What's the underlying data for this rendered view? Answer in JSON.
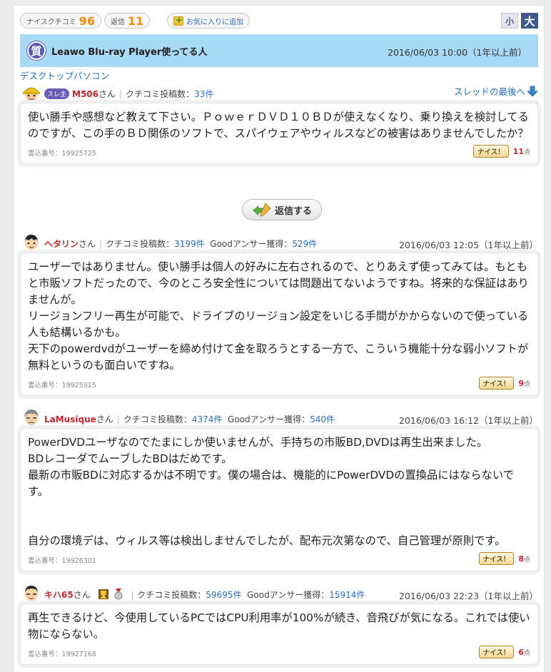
{
  "toolbar": {
    "nice_label": "ナイスクチコミ",
    "nice_count": "96",
    "reply_label": "返信",
    "reply_count": "11",
    "favorite_label": "お気に入りに追加",
    "size_small": "小",
    "size_large": "大"
  },
  "question": {
    "badge": "質",
    "title": "Leawo Blu-ray Player使ってる人",
    "date": "2016/06/03 10:00（1年以上前）",
    "category": "デスクトップパソコン",
    "last_link": "スレッドの最後へ"
  },
  "reply_button": "返信する",
  "labels": {
    "san": "さん",
    "post_count": "クチコミ投稿数：",
    "good_answer": "Goodアンサー獲得：",
    "thread_owner": "スレ主",
    "nice": "ナイス！",
    "points_unit": "点"
  },
  "posts": [
    {
      "user": "M506",
      "posts_count": "33件",
      "good_count": "",
      "date": "",
      "body": "使い勝手や感想など教えて下さい。ＰｏｗｅｒＤＶＤ１０ＢＤが使えなくなり、乗り換えを検討してるのですが、この手のＢＤ関係のソフトで、スパイウェアやウィルスなどの被害はありませんでしたか？",
      "post_no": "書込番号：19925725",
      "points": "11"
    },
    {
      "user": "ヘタリン",
      "posts_count": "3199件",
      "good_count": "529件",
      "date": "2016/06/03 12:05（1年以上前）",
      "body": "ユーザーではありません。使い勝手は個人の好みに左右されるので、とりあえず使ってみては。もともと市販ソフトだったので、今のところ安全性については問題出てないようですね。将来的な保証はありませんが。\nリージョンフリー再生が可能で、ドライブのリージョン設定をいじる手間がかからないので使っている人も結構いるかも。\n天下のpowerdvdがユーザーを締め付けて金を取ろうとする一方で、こういう機能十分な弱小ソフトが無料というのも面白いですね。",
      "post_no": "書込番号：19925915",
      "points": "9"
    },
    {
      "user": "LaMusique",
      "posts_count": "4374件",
      "good_count": "540件",
      "date": "2016/06/03 16:12（1年以上前）",
      "body": "PowerDVDユーザなのでたまにしか使いませんが、手持ちの市販BD,DVDは再生出来ました。\nBDレコーダでムーブしたBDはだめです。\n最新の市販BDに対応するかは不明です。僕の場合は、機能的にPowerDVDの置換品にはならないです。\n\n\n自分の環境デは、ウィルス等は検出しませんでしたが、配布元次第なので、自己管理が原則です。",
      "post_no": "書込番号：19926301",
      "points": "8"
    },
    {
      "user": "キハ65",
      "posts_count": "59695件",
      "good_count": "15914件",
      "date": "2016/06/03 22:23（1年以上前）",
      "body": "再生できるけど、今使用しているPCではCPU利用率が100%が続き、音飛びが気になる。これでは使い物にならない。",
      "post_no": "書込番号：19927168",
      "points": "6"
    }
  ]
}
